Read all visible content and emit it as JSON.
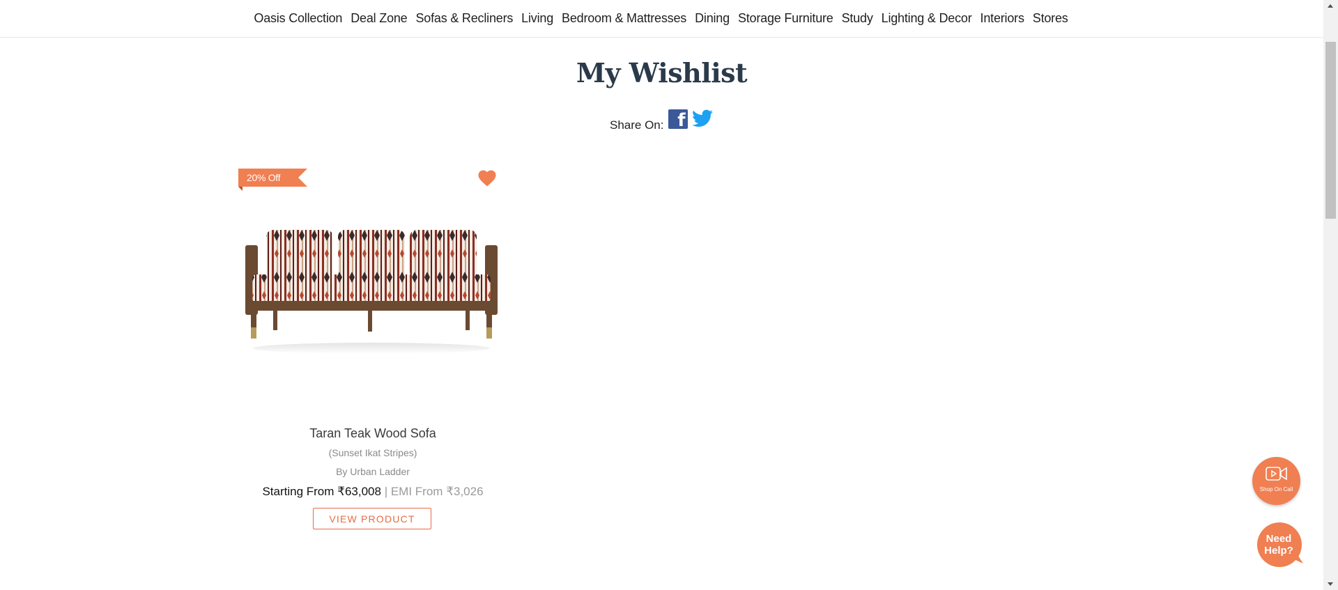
{
  "nav": {
    "items": [
      "Oasis Collection",
      "Deal Zone",
      "Sofas & Recliners",
      "Living",
      "Bedroom & Mattresses",
      "Dining",
      "Storage Furniture",
      "Study",
      "Lighting & Decor",
      "Interiors",
      "Stores"
    ]
  },
  "page": {
    "title": "My Wishlist",
    "share_label": "Share On:",
    "facebook_glyph": "f"
  },
  "product": {
    "badge": "20% Off",
    "name": "Taran Teak Wood Sofa",
    "variant": "(Sunset Ikat Stripes)",
    "brand": "By Urban Ladder",
    "price_prefix": "Starting From ",
    "price": "₹63,008",
    "separator": " | ",
    "emi_label": "EMI From ",
    "emi": "₹3,026",
    "cta": "VIEW PRODUCT"
  },
  "floating": {
    "call_label": "Shop On Call",
    "help_label": "Need Help?"
  },
  "colors": {
    "accent": "#f07f52",
    "facebook": "#3b5998",
    "twitter": "#1da1f2",
    "title": "#2b3a4a"
  },
  "icons": {
    "heart": "heart-icon",
    "facebook": "facebook-icon",
    "twitter": "twitter-icon",
    "video": "video-camera-icon"
  }
}
